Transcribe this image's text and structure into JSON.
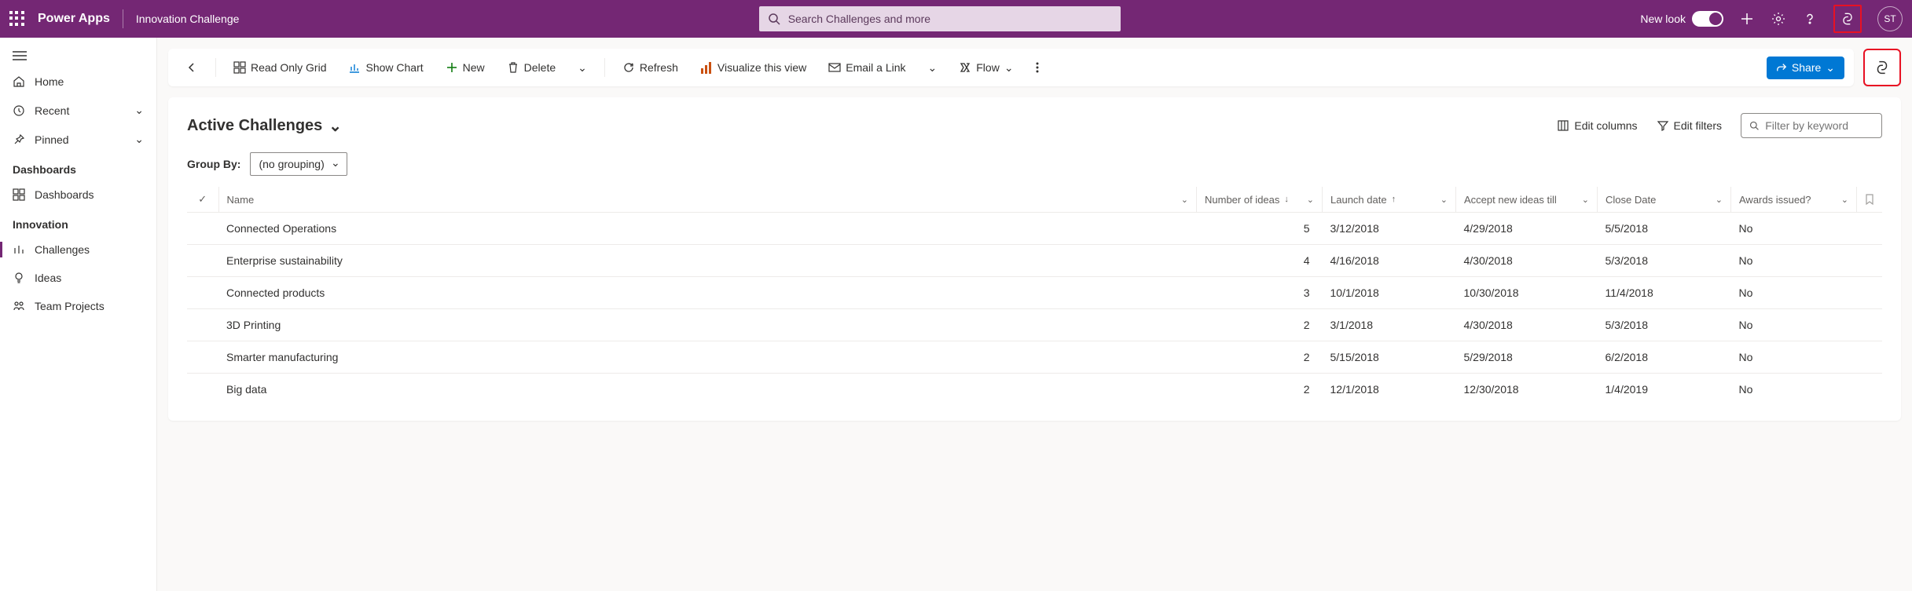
{
  "header": {
    "brand": "Power Apps",
    "app_title": "Innovation Challenge",
    "search_placeholder": "Search Challenges and more",
    "new_look_label": "New look",
    "avatar_initials": "ST"
  },
  "sidebar": {
    "items": [
      {
        "icon": "home",
        "label": "Home",
        "chevron": false
      },
      {
        "icon": "recent",
        "label": "Recent",
        "chevron": true
      },
      {
        "icon": "pinned",
        "label": "Pinned",
        "chevron": true
      }
    ],
    "sections": [
      {
        "title": "Dashboards",
        "items": [
          {
            "icon": "dashboards",
            "label": "Dashboards",
            "active": false
          }
        ]
      },
      {
        "title": "Innovation",
        "items": [
          {
            "icon": "challenges",
            "label": "Challenges",
            "active": true
          },
          {
            "icon": "ideas",
            "label": "Ideas",
            "active": false
          },
          {
            "icon": "team",
            "label": "Team Projects",
            "active": false
          }
        ]
      }
    ]
  },
  "commandbar": {
    "read_only_grid": "Read Only Grid",
    "show_chart": "Show Chart",
    "new": "New",
    "delete": "Delete",
    "refresh": "Refresh",
    "visualize": "Visualize this view",
    "email_link": "Email a Link",
    "flow": "Flow",
    "share": "Share"
  },
  "view": {
    "title": "Active Challenges",
    "edit_columns": "Edit columns",
    "edit_filters": "Edit filters",
    "filter_placeholder": "Filter by keyword",
    "group_by_label": "Group By:",
    "group_by_value": "(no grouping)"
  },
  "columns": {
    "name": "Name",
    "number_of_ideas": "Number of ideas",
    "launch_date": "Launch date",
    "accept_until": "Accept new ideas till",
    "close_date": "Close Date",
    "awards_issued": "Awards issued?"
  },
  "rows": [
    {
      "name": "Connected Operations",
      "ideas": "5",
      "launch": "3/12/2018",
      "accept": "4/29/2018",
      "close": "5/5/2018",
      "awards": "No"
    },
    {
      "name": "Enterprise sustainability",
      "ideas": "4",
      "launch": "4/16/2018",
      "accept": "4/30/2018",
      "close": "5/3/2018",
      "awards": "No"
    },
    {
      "name": "Connected products",
      "ideas": "3",
      "launch": "10/1/2018",
      "accept": "10/30/2018",
      "close": "11/4/2018",
      "awards": "No"
    },
    {
      "name": "3D Printing",
      "ideas": "2",
      "launch": "3/1/2018",
      "accept": "4/30/2018",
      "close": "5/3/2018",
      "awards": "No"
    },
    {
      "name": "Smarter manufacturing",
      "ideas": "2",
      "launch": "5/15/2018",
      "accept": "5/29/2018",
      "close": "6/2/2018",
      "awards": "No"
    },
    {
      "name": "Big data",
      "ideas": "2",
      "launch": "12/1/2018",
      "accept": "12/30/2018",
      "close": "1/4/2019",
      "awards": "No"
    }
  ]
}
